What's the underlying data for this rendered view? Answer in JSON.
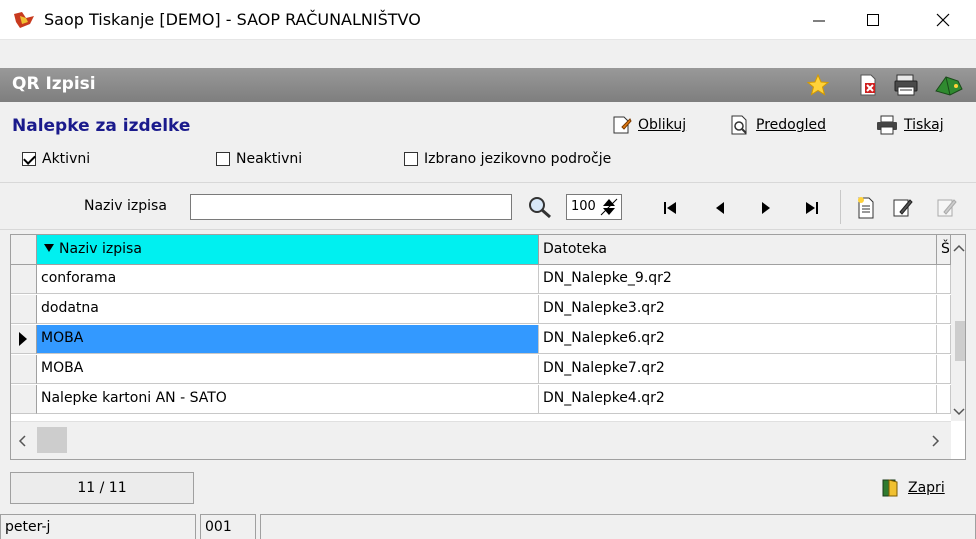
{
  "window": {
    "title": "Saop Tiskanje [DEMO] - SAOP RAČUNALNIŠTVO"
  },
  "header": {
    "title": "QR Izpisi"
  },
  "section": {
    "title": "Nalepke za izdelke"
  },
  "actions": {
    "oblikuj": "Oblikuj",
    "predogled": "Predogled",
    "tiskaj": "Tiskaj"
  },
  "filters": {
    "aktivni": {
      "label": "Aktivni",
      "checked": true
    },
    "neaktivni": {
      "label": "Neaktivni",
      "checked": false
    },
    "izbrano": {
      "label": "Izbrano jezikovno področje",
      "checked": false
    }
  },
  "search": {
    "label": "Naziv izpisa",
    "value": "",
    "limit": "100"
  },
  "grid": {
    "columns": [
      "Naziv izpisa",
      "Datoteka",
      "Št"
    ],
    "rows": [
      {
        "naziv": "conforama",
        "datoteka": "DN_Nalepke_9.qr2",
        "selected": false
      },
      {
        "naziv": "dodatna",
        "datoteka": "DN_Nalepke3.qr2",
        "selected": false
      },
      {
        "naziv": "MOBA",
        "datoteka": "DN_Nalepke6.qr2",
        "selected": true
      },
      {
        "naziv": "MOBA",
        "datoteka": "DN_Nalepke7.qr2",
        "selected": false
      },
      {
        "naziv": "Nalepke kartoni AN - SATO",
        "datoteka": "DN_Nalepke4.qr2",
        "selected": false
      }
    ]
  },
  "footer": {
    "record_count": "11 / 11",
    "close_label": "Zapri"
  },
  "status": {
    "user": "peter-j",
    "code": "001"
  },
  "colors": {
    "header_bg": "#8a8a8a",
    "section_title": "#1a1a8c",
    "sorted_column": "#00f0f0",
    "selection": "#3399ff"
  }
}
